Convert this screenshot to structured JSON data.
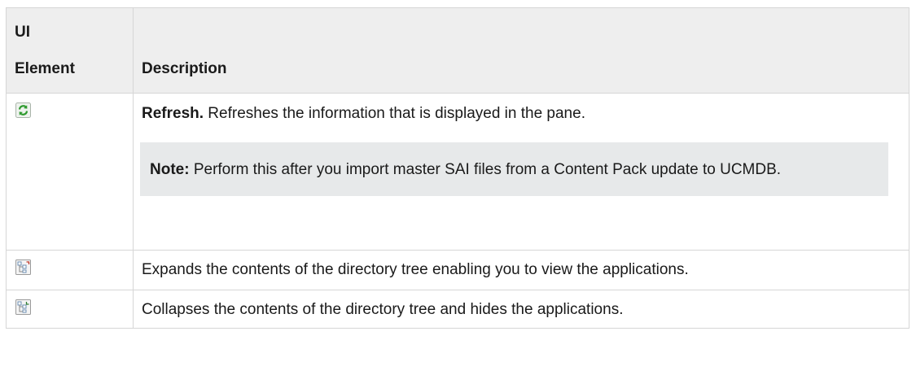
{
  "header": {
    "col1_line1": "UI",
    "col1_line2": "Element",
    "col2": "Description"
  },
  "rows": [
    {
      "icon": "refresh-icon",
      "title": "Refresh.",
      "text": " Refreshes the information that is displayed in the pane.",
      "note_label": "Note:",
      "note_text": " Perform this after you import master SAI files from a Content Pack update to UCMDB."
    },
    {
      "icon": "expand-tree-icon",
      "text": "Expands the contents of the directory tree enabling you to view the applications."
    },
    {
      "icon": "collapse-tree-icon",
      "text": "Collapses the contents of the directory tree and hides the applications."
    }
  ],
  "colors": {
    "header_bg": "#eeeeee",
    "note_bg": "#e7e9ea",
    "border": "#d6d6d6"
  }
}
